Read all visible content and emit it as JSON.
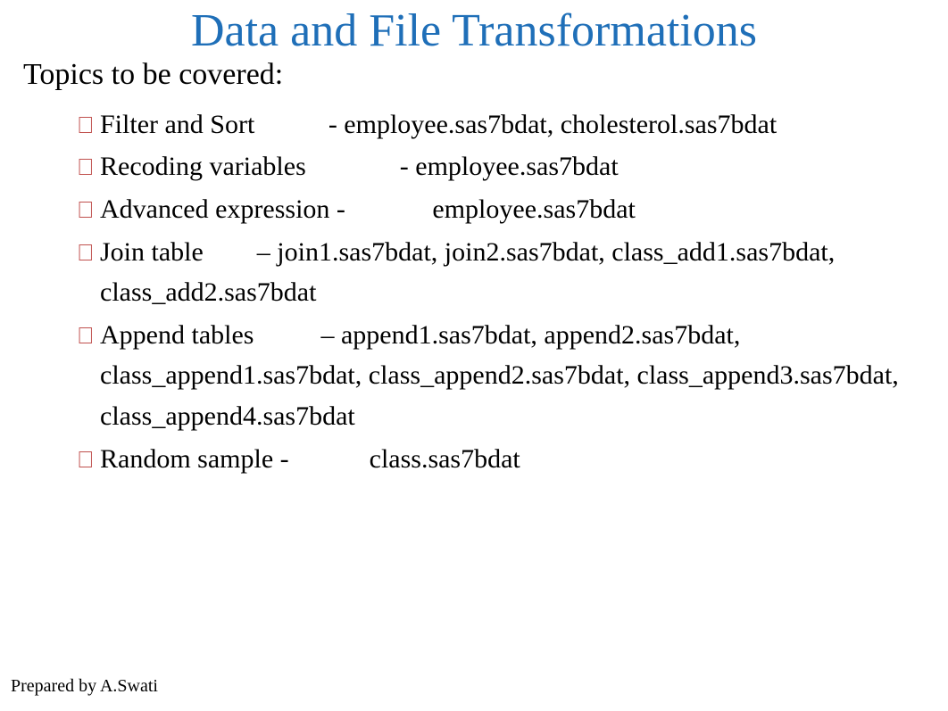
{
  "title": "Data and File Transformations",
  "subtitle": "Topics to be covered:",
  "topics": [
    "Filter and Sort           - employee.sas7bdat, cholesterol.sas7bdat",
    "Recoding variables              - employee.sas7bdat",
    "Advanced expression -             employee.sas7bdat",
    "Join table        – join1.sas7bdat, join2.sas7bdat, class_add1.sas7bdat, class_add2.sas7bdat",
    "Append tables          – append1.sas7bdat, append2.sas7bdat, class_append1.sas7bdat, class_append2.sas7bdat, class_append3.sas7bdat, class_append4.sas7bdat",
    "Random sample -            class.sas7bdat"
  ],
  "footer": "Prepared by A.Swati",
  "bullet_glyph": ""
}
